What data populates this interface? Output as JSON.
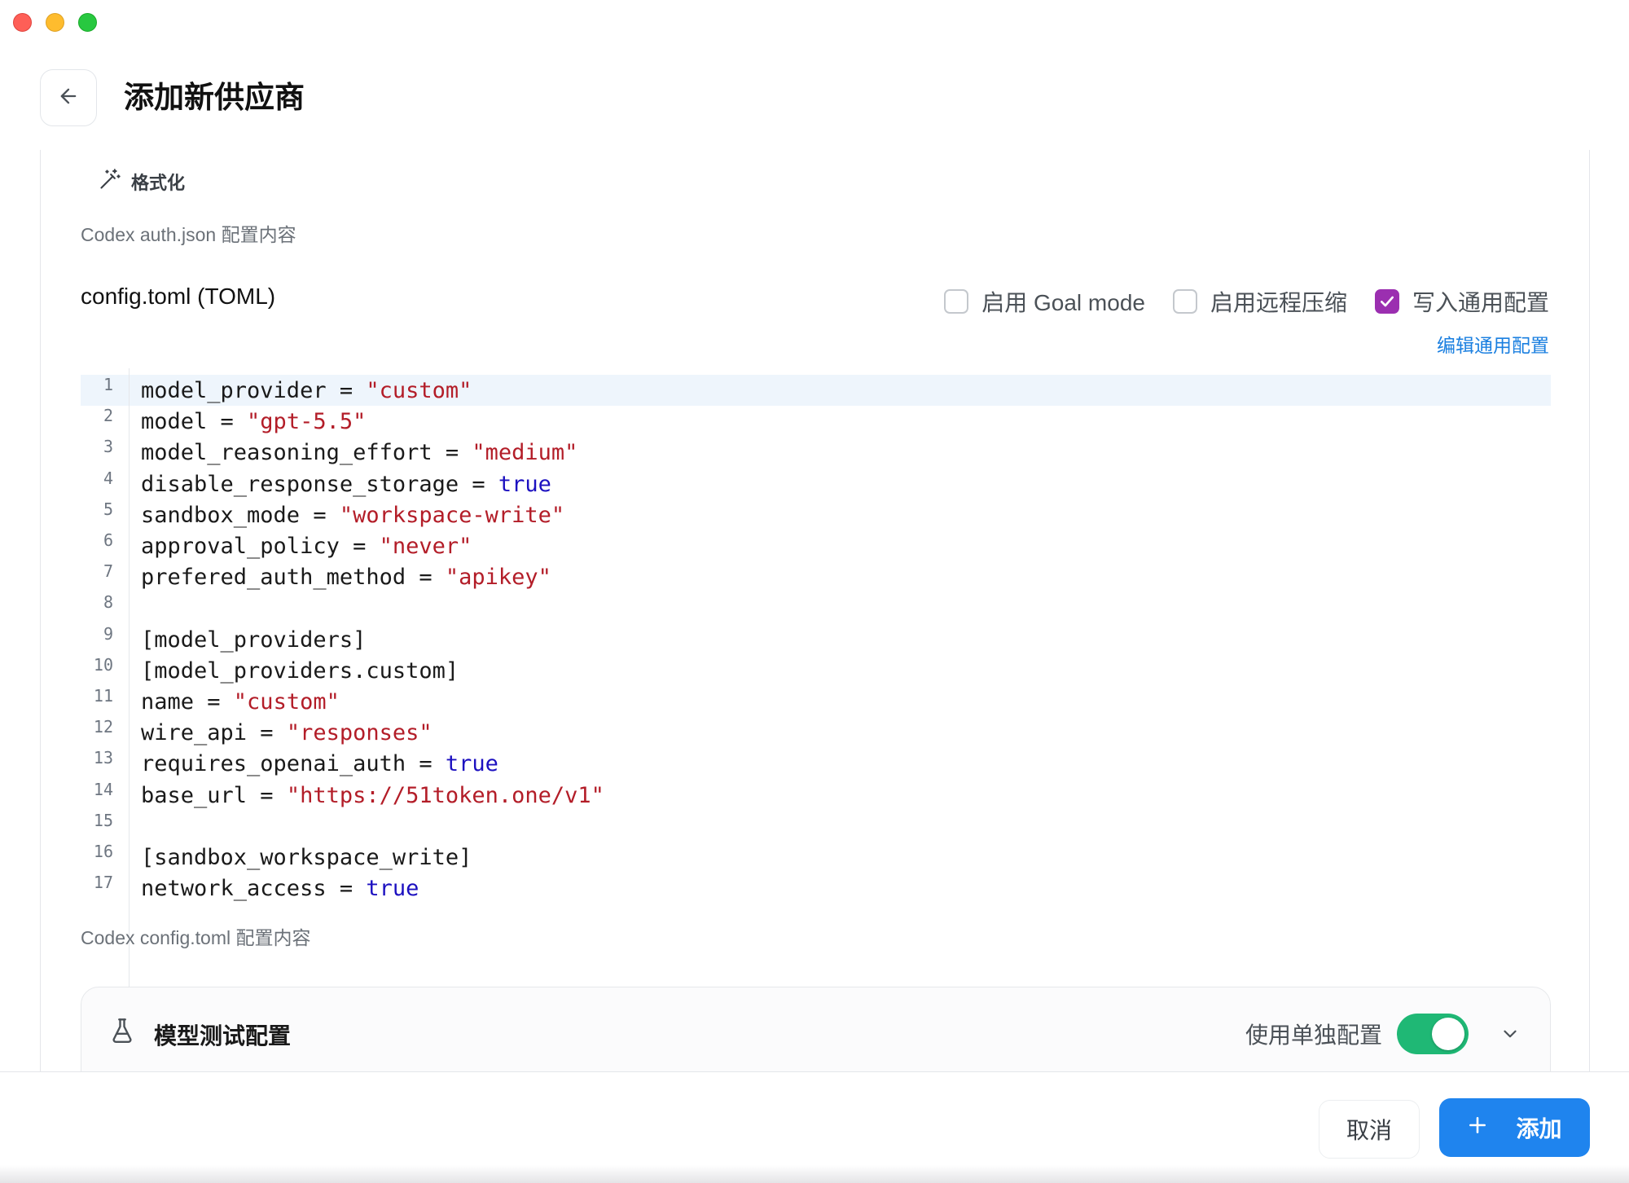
{
  "window": {
    "controls": [
      "close",
      "minimize",
      "zoom"
    ]
  },
  "header": {
    "back_icon": "arrow-left-icon",
    "title": "添加新供应商"
  },
  "auth_section": {
    "format_label": "格式化",
    "format_icon": "magic-wand-icon",
    "hint": "Codex auth.json 配置内容"
  },
  "config_section": {
    "title": "config.toml (TOML)",
    "options": [
      {
        "label": "启用 Goal mode",
        "checked": false
      },
      {
        "label": "启用远程压缩",
        "checked": false
      },
      {
        "label": "写入通用配置",
        "checked": true
      }
    ],
    "edit_link": "编辑通用配置",
    "hint": "Codex config.toml 配置内容",
    "active_line": 1,
    "lines": [
      {
        "num": "1",
        "key": "model_provider = ",
        "value": "\"custom\"",
        "type": "string"
      },
      {
        "num": "2",
        "key": "model = ",
        "value": "\"gpt-5.5\"",
        "type": "string"
      },
      {
        "num": "3",
        "key": "model_reasoning_effort = ",
        "value": "\"medium\"",
        "type": "string"
      },
      {
        "num": "4",
        "key": "disable_response_storage = ",
        "value": "true",
        "type": "bool"
      },
      {
        "num": "5",
        "key": "sandbox_mode = ",
        "value": "\"workspace-write\"",
        "type": "string"
      },
      {
        "num": "6",
        "key": "approval_policy = ",
        "value": "\"never\"",
        "type": "string"
      },
      {
        "num": "7",
        "key": "prefered_auth_method = ",
        "value": "\"apikey\"",
        "type": "string"
      },
      {
        "num": "8",
        "key": "",
        "value": "",
        "type": "plain"
      },
      {
        "num": "9",
        "key": "[model_providers]",
        "value": "",
        "type": "plain"
      },
      {
        "num": "10",
        "key": "[model_providers.custom]",
        "value": "",
        "type": "plain"
      },
      {
        "num": "11",
        "key": "name = ",
        "value": "\"custom\"",
        "type": "string"
      },
      {
        "num": "12",
        "key": "wire_api = ",
        "value": "\"responses\"",
        "type": "string"
      },
      {
        "num": "13",
        "key": "requires_openai_auth = ",
        "value": "true",
        "type": "bool"
      },
      {
        "num": "14",
        "key": "base_url = ",
        "value": "\"https://51token.one/v1\"",
        "type": "string"
      },
      {
        "num": "15",
        "key": "",
        "value": "",
        "type": "plain"
      },
      {
        "num": "16",
        "key": "[sandbox_workspace_write]",
        "value": "",
        "type": "plain"
      },
      {
        "num": "17",
        "key": "network_access = ",
        "value": "true",
        "type": "bool"
      }
    ]
  },
  "model_test": {
    "icon": "flask-icon",
    "title": "模型测试配置",
    "toggle_label": "使用单独配置",
    "toggle_on": true,
    "expand_icon": "chevron-down-icon"
  },
  "footer": {
    "cancel_label": "取消",
    "add_label": "添加",
    "add_icon": "plus-icon"
  },
  "colors": {
    "accent_blue": "#1f84ee",
    "checkbox_purple": "#9b2fb0",
    "toggle_green": "#1fb875",
    "string_red": "#b31d28",
    "bool_blue": "#1c10c0"
  }
}
